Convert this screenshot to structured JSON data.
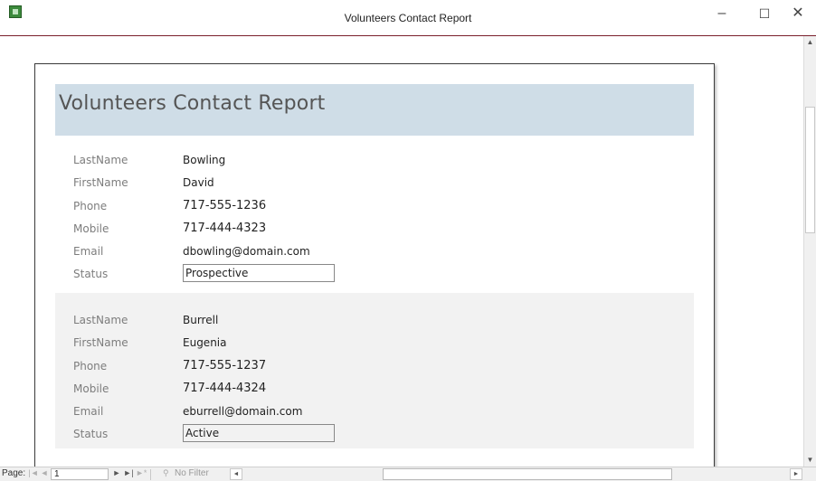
{
  "window": {
    "title": "Volunteers Contact Report",
    "minimize_icon": "–",
    "maximize_icon": "☐",
    "close_icon": "✕"
  },
  "report": {
    "title": "Volunteers Contact Report",
    "labels": {
      "last_name": "LastName",
      "first_name": "FirstName",
      "phone": "Phone",
      "mobile": "Mobile",
      "email": "Email",
      "status": "Status"
    },
    "records": [
      {
        "last_name": "Bowling",
        "first_name": "David",
        "phone": "717-555-1236",
        "mobile": "717-444-4323",
        "email": "dbowling@domain.com",
        "status": "Prospective"
      },
      {
        "last_name": "Burrell",
        "first_name": "Eugenia",
        "phone": "717-555-1237",
        "mobile": "717-444-4324",
        "email": "eburrell@domain.com",
        "status": "Active"
      }
    ]
  },
  "navigation": {
    "page_label": "Page:",
    "page_number": "1",
    "first_icon": "|◄",
    "prev_icon": "◄",
    "next_icon": "►",
    "last_icon": "►|",
    "new_icon": "►*",
    "filter_icon": "⚲",
    "filter_label": "No Filter",
    "hscroll_left_icon": "◄",
    "hscroll_right_icon": "►"
  },
  "scrollbar": {
    "up_icon": "▲",
    "down_icon": "▼"
  },
  "colors": {
    "header_band": "#cfdde7",
    "alt_record": "#f2f2f2",
    "title_border": "#7a1f2b"
  }
}
